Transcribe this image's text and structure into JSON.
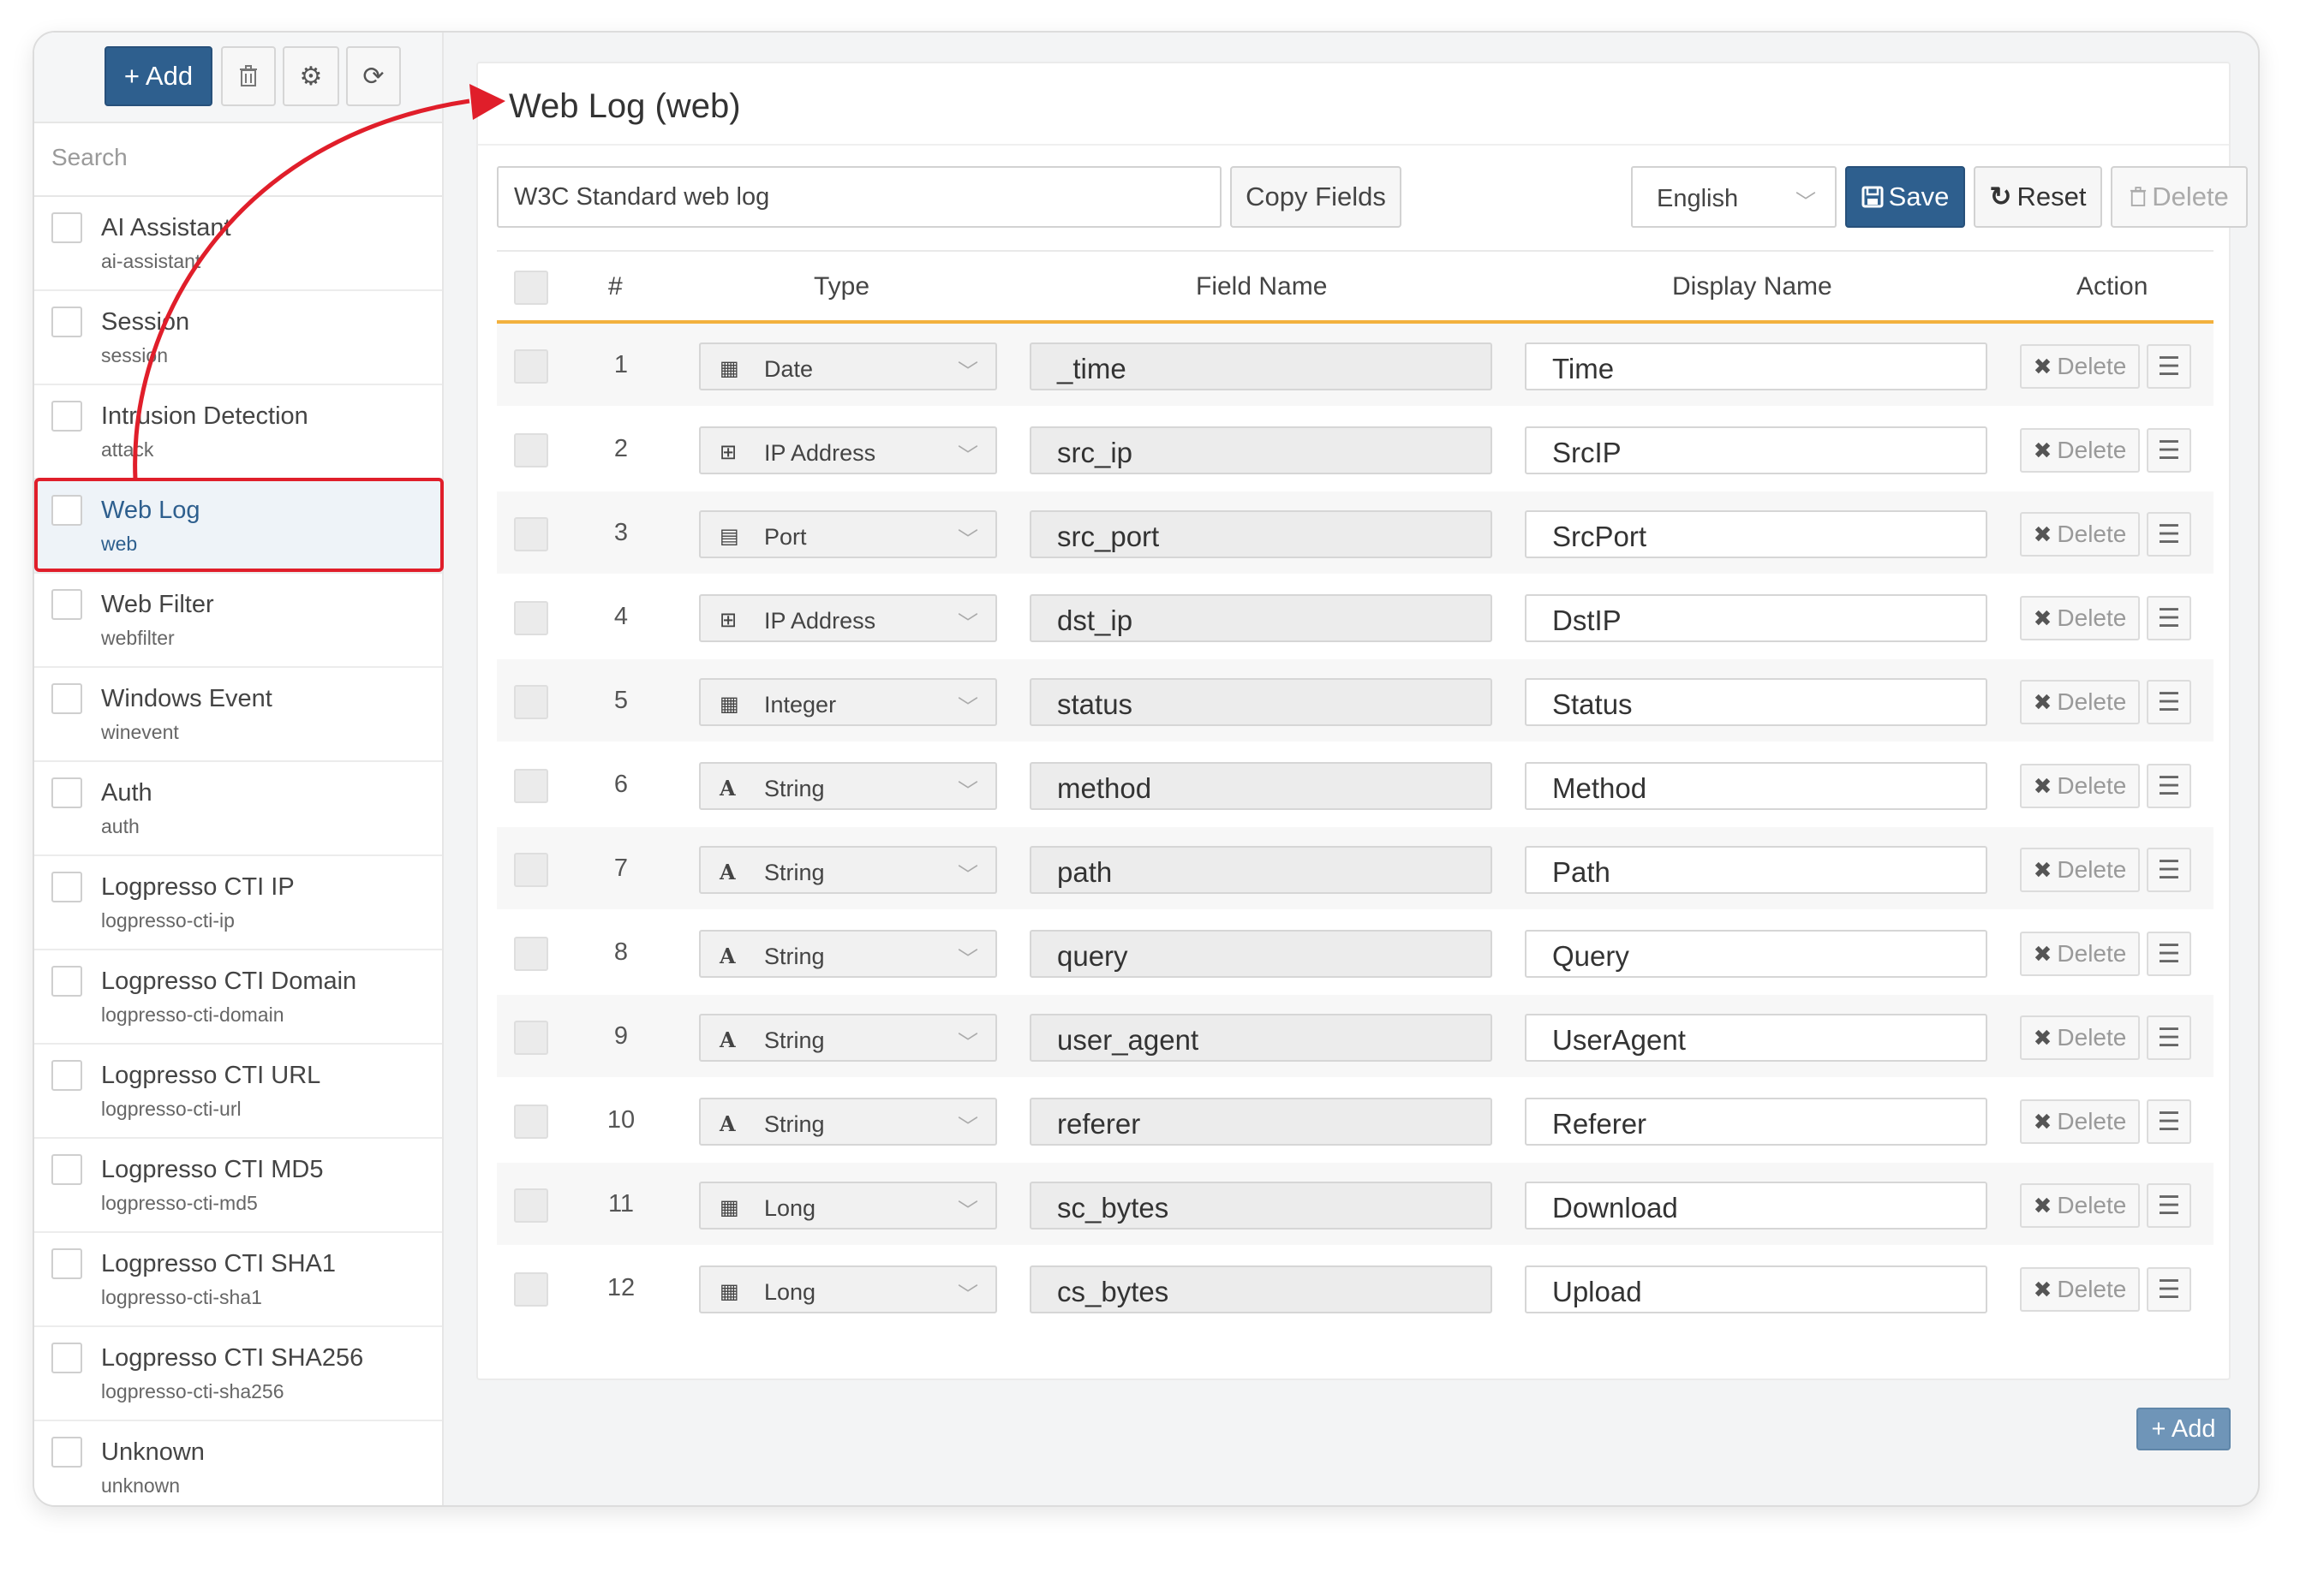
{
  "toolbar": {
    "add_label": "+ Add",
    "delete_icon": "trash-icon",
    "settings_icon": "gear-icon",
    "refresh_icon": "refresh-icon"
  },
  "search": {
    "placeholder": "Search"
  },
  "sidebar": {
    "items": [
      {
        "name": "AI Assistant",
        "code": "ai-assistant"
      },
      {
        "name": "Session",
        "code": "session"
      },
      {
        "name": "Intrusion Detection",
        "code": "attack"
      },
      {
        "name": "Web Log",
        "code": "web",
        "active": true
      },
      {
        "name": "Web Filter",
        "code": "webfilter"
      },
      {
        "name": "Windows Event",
        "code": "winevent"
      },
      {
        "name": "Auth",
        "code": "auth"
      },
      {
        "name": "Logpresso CTI IP",
        "code": "logpresso-cti-ip"
      },
      {
        "name": "Logpresso CTI Domain",
        "code": "logpresso-cti-domain"
      },
      {
        "name": "Logpresso CTI URL",
        "code": "logpresso-cti-url"
      },
      {
        "name": "Logpresso CTI MD5",
        "code": "logpresso-cti-md5"
      },
      {
        "name": "Logpresso CTI SHA1",
        "code": "logpresso-cti-sha1"
      },
      {
        "name": "Logpresso CTI SHA256",
        "code": "logpresso-cti-sha256"
      },
      {
        "name": "Unknown",
        "code": "unknown"
      }
    ]
  },
  "main": {
    "title": "Web Log (web)",
    "description": "W3C Standard web log",
    "copy_fields_label": "Copy Fields",
    "language": "English",
    "save_label": "Save",
    "reset_label": "Reset",
    "delete_label": "Delete",
    "columns": {
      "num": "#",
      "type": "Type",
      "field": "Field Name",
      "display": "Display Name",
      "action": "Action"
    },
    "row_delete_label": "Delete",
    "bottom_add_label": "+ Add",
    "rows": [
      {
        "num": "1",
        "type": "Date",
        "type_icon": "calendar-icon",
        "field": "_time",
        "display": "Time"
      },
      {
        "num": "2",
        "type": "IP Address",
        "type_icon": "network-icon",
        "field": "src_ip",
        "display": "SrcIP"
      },
      {
        "num": "3",
        "type": "Port",
        "type_icon": "port-icon",
        "field": "src_port",
        "display": "SrcPort"
      },
      {
        "num": "4",
        "type": "IP Address",
        "type_icon": "network-icon",
        "field": "dst_ip",
        "display": "DstIP"
      },
      {
        "num": "5",
        "type": "Integer",
        "type_icon": "calculator-icon",
        "field": "status",
        "display": "Status"
      },
      {
        "num": "6",
        "type": "String",
        "type_icon": "font-icon",
        "field": "method",
        "display": "Method"
      },
      {
        "num": "7",
        "type": "String",
        "type_icon": "font-icon",
        "field": "path",
        "display": "Path"
      },
      {
        "num": "8",
        "type": "String",
        "type_icon": "font-icon",
        "field": "query",
        "display": "Query"
      },
      {
        "num": "9",
        "type": "String",
        "type_icon": "font-icon",
        "field": "user_agent",
        "display": "UserAgent"
      },
      {
        "num": "10",
        "type": "String",
        "type_icon": "font-icon",
        "field": "referer",
        "display": "Referer"
      },
      {
        "num": "11",
        "type": "Long",
        "type_icon": "calculator-icon",
        "field": "sc_bytes",
        "display": "Download"
      },
      {
        "num": "12",
        "type": "Long",
        "type_icon": "calculator-icon",
        "field": "cs_bytes",
        "display": "Upload"
      }
    ]
  },
  "colors": {
    "primary": "#2e5f8e",
    "highlight": "#e01e2a",
    "header_rule": "#f2b13e"
  }
}
